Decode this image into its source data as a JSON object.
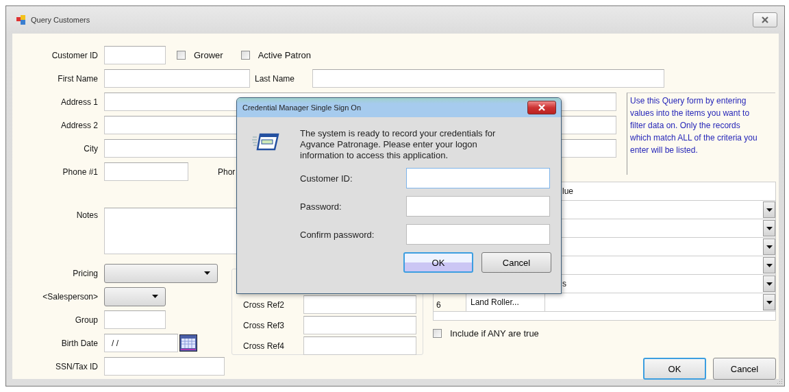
{
  "window": {
    "title": "Query Customers"
  },
  "form": {
    "customer_id_label": "Customer ID",
    "checkboxes": [
      {
        "label": "Grower",
        "checked": false
      },
      {
        "label": "Active Patron",
        "checked": false
      }
    ],
    "first_name_label": "First Name",
    "last_name_label": "Last Name",
    "address_rows": [
      {
        "label": "Address 1"
      },
      {
        "label": "Address 2"
      },
      {
        "label": "City"
      }
    ],
    "phone_label": "Phone #1",
    "phone_2_label": "Phor",
    "help_text": "Use this Query form by entering values into the items you want to filter data on. Only the records which match ALL of the criteria you enter will be listed.",
    "notes_label": "Notes",
    "pricing_label": "Pricing",
    "salesperson_label": "<Salesperson>",
    "group_label": "Group",
    "birth_date": {
      "label": "Birth Date",
      "value": "/ /"
    },
    "ssn_label": "SSN/Tax ID",
    "cross_refs": [
      {
        "label": "Cross Ref2"
      },
      {
        "label": "Cross Ref3"
      },
      {
        "label": "Cross Ref4"
      }
    ]
  },
  "criteria_grid": {
    "header_column_3": "lue",
    "rows": [
      {
        "kind": "covered"
      },
      {
        "kind": "covered"
      },
      {
        "kind": "covered"
      },
      {
        "kind": "covered"
      },
      {
        "kind": "covered",
        "column_3": "s"
      },
      {
        "kind": "full",
        "number": "6",
        "description": "Land Roller..."
      }
    ]
  },
  "include_any": {
    "label": "Include if ANY are true",
    "checked": false
  },
  "buttons": [
    {
      "label": "OK",
      "default": true
    },
    {
      "label": "Cancel",
      "default": false
    }
  ],
  "dialog": {
    "title": "Credential Manager Single Sign On",
    "message": "The system is ready to record your credentials for Agvance Patronage.  Please enter your logon information to access this application.",
    "fields": [
      {
        "label": "Customer ID:",
        "focused": true
      },
      {
        "label": "Password:",
        "focused": false
      },
      {
        "label": "Confirm password:",
        "focused": false
      }
    ],
    "buttons": [
      {
        "label": "OK",
        "default": true
      },
      {
        "label": "Cancel",
        "default": false
      }
    ]
  }
}
